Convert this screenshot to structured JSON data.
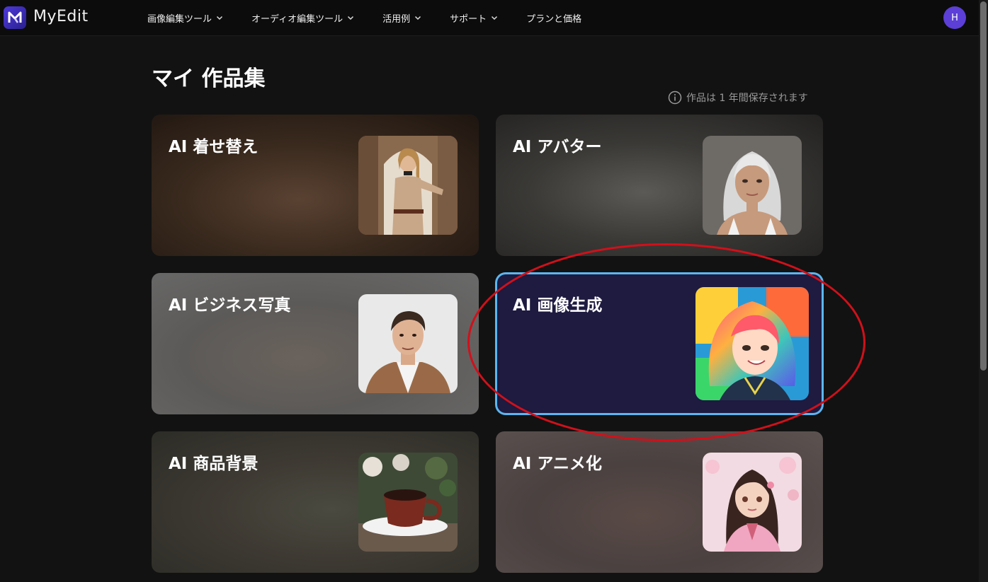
{
  "brand": {
    "name": "MyEdit"
  },
  "nav": {
    "items": [
      {
        "label": "画像編集ツール",
        "has_dropdown": true
      },
      {
        "label": "オーディオ編集ツール",
        "has_dropdown": true
      },
      {
        "label": "活用例",
        "has_dropdown": true
      },
      {
        "label": "サポート",
        "has_dropdown": true
      },
      {
        "label": "プランと価格",
        "has_dropdown": false
      }
    ]
  },
  "user": {
    "avatar_initial": "H"
  },
  "page": {
    "title": "マイ 作品集",
    "save_note": "作品は 1 年間保存されます"
  },
  "cards": [
    {
      "title": "AI 着せ替え",
      "thumb_icon": "fashion-woman-thumbnail"
    },
    {
      "title": "AI アバター",
      "thumb_icon": "avatar-silver-hair-thumbnail"
    },
    {
      "title": "AI ビジネス写真",
      "thumb_icon": "business-man-thumbnail"
    },
    {
      "title": "AI 画像生成",
      "thumb_icon": "anime-colorful-hair-thumbnail",
      "highlighted": true
    },
    {
      "title": "AI 商品背景",
      "thumb_icon": "coffee-cup-thumbnail"
    },
    {
      "title": "AI アニメ化",
      "thumb_icon": "anime-girl-sakura-thumbnail"
    }
  ],
  "colors": {
    "background": "#121212",
    "accent_purple": "#5b3fd6",
    "active_border": "#5bb6f0",
    "annotation_red": "#d1101a"
  }
}
